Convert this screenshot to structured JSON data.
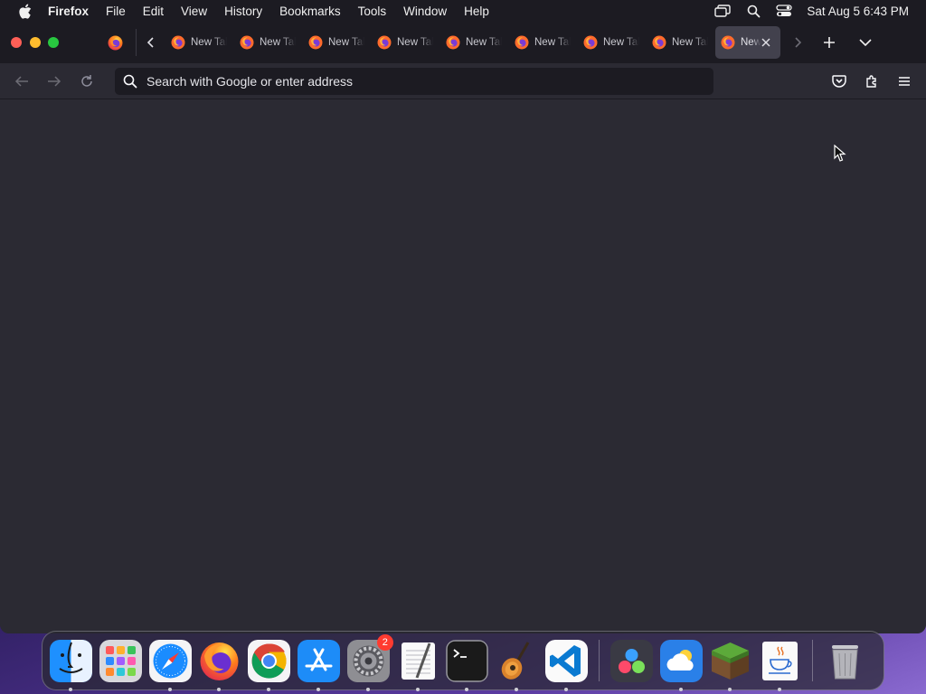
{
  "menubar": {
    "app_name": "Firefox",
    "items": [
      "File",
      "Edit",
      "View",
      "History",
      "Bookmarks",
      "Tools",
      "Window",
      "Help"
    ],
    "clock": "Sat Aug 5  6:43 PM"
  },
  "tabs": {
    "items": [
      {
        "title": "New Tab"
      },
      {
        "title": "New Tab"
      },
      {
        "title": "New Tab"
      },
      {
        "title": "New Tab"
      },
      {
        "title": "New Tab"
      },
      {
        "title": "New Tab"
      },
      {
        "title": "New Tab"
      },
      {
        "title": "New Tab"
      },
      {
        "title": "New Tab",
        "active": true
      }
    ]
  },
  "navbar": {
    "url_placeholder": "Search with Google or enter address"
  },
  "dock": {
    "apps": [
      {
        "name": "Finder",
        "running": true
      },
      {
        "name": "Launchpad",
        "running": false
      },
      {
        "name": "Safari",
        "running": true
      },
      {
        "name": "Firefox",
        "running": true
      },
      {
        "name": "Google Chrome",
        "running": true
      },
      {
        "name": "App Store",
        "running": true
      },
      {
        "name": "System Settings",
        "running": true,
        "badge": "2"
      },
      {
        "name": "TextEdit",
        "running": true
      },
      {
        "name": "Terminal",
        "running": true
      },
      {
        "name": "GarageBand",
        "running": true
      },
      {
        "name": "Visual Studio Code",
        "running": true
      },
      {
        "name": "DaVinci Resolve",
        "running": false
      },
      {
        "name": "Weather",
        "running": true
      },
      {
        "name": "Minecraft",
        "running": true
      },
      {
        "name": "Java",
        "running": true
      },
      {
        "name": "Trash",
        "running": false
      }
    ],
    "badge_system_settings": "2"
  },
  "colors": {
    "window_bg": "#2b2a33",
    "toolbar_bg": "#1c1b22",
    "active_tab": "#42414d",
    "accent": "#ff5f57"
  }
}
